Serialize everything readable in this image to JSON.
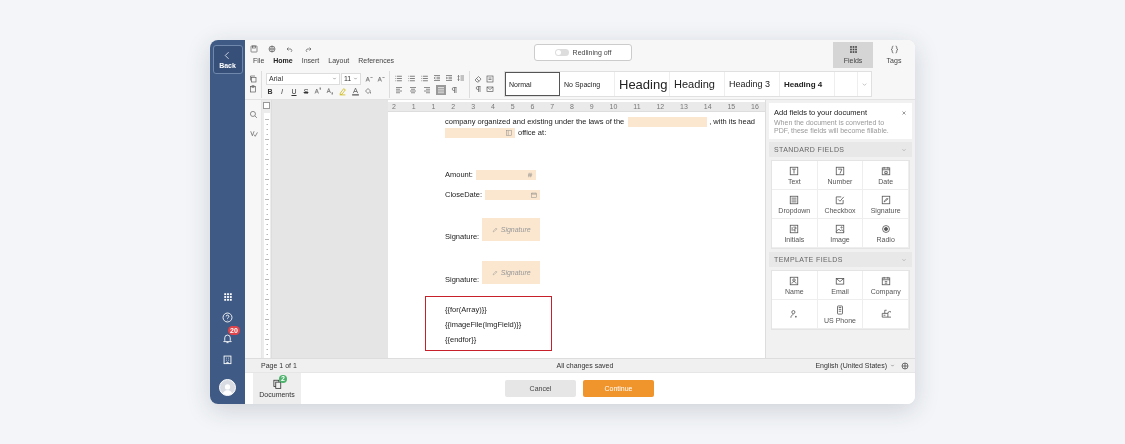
{
  "nav": {
    "back_label": "Back",
    "notification_count": "20"
  },
  "toolbar": {
    "menu_tabs": [
      {
        "label": "File",
        "selected": false
      },
      {
        "label": "Home",
        "selected": true
      },
      {
        "label": "Insert",
        "selected": false
      },
      {
        "label": "Layout",
        "selected": false
      },
      {
        "label": "References",
        "selected": false
      }
    ],
    "redlining": {
      "label": "Redlining off",
      "on": false
    },
    "panel_buttons": [
      {
        "label": "Fields",
        "kind": "fields",
        "selected": true
      },
      {
        "label": "Tags",
        "kind": "tags",
        "selected": false
      }
    ],
    "font": {
      "family": "Arial",
      "size": "11"
    },
    "format_buttons": [
      "B",
      "I",
      "U",
      "S"
    ],
    "align_buttons": [
      {
        "kind": "left",
        "selected": false
      },
      {
        "kind": "center",
        "selected": false
      },
      {
        "kind": "right",
        "selected": false
      },
      {
        "kind": "justify",
        "selected": true
      }
    ],
    "styles": [
      {
        "label": "Normal",
        "kind": "normal",
        "selected": true
      },
      {
        "label": "No Spacing",
        "kind": "nospacing",
        "selected": false
      },
      {
        "label": "Heading",
        "kind": "heading1",
        "selected": false
      },
      {
        "label": "Heading",
        "kind": "heading2",
        "selected": false
      },
      {
        "label": "Heading 3",
        "kind": "heading3",
        "selected": false
      },
      {
        "label": "Heading 4",
        "kind": "heading4",
        "selected": false
      }
    ]
  },
  "ruler": {
    "labels": [
      "2",
      "1",
      "1",
      "2",
      "3",
      "4",
      "5",
      "6",
      "7",
      "8",
      "9",
      "10",
      "11",
      "12",
      "13",
      "14",
      "15",
      "16"
    ]
  },
  "document": {
    "intro_before": "company organized and existing under the laws of the",
    "intro_after": ", with its head",
    "intro_next": "office at:",
    "lines": [
      {
        "label": "Amount:",
        "kind": "number"
      },
      {
        "label": "CloseDate:",
        "kind": "date"
      },
      {
        "label": "Signature:",
        "kind": "signature",
        "field_text": "Signature"
      },
      {
        "label": "Signature:",
        "kind": "signature",
        "field_text": "Signature"
      }
    ],
    "template_block": [
      "{{for(Array)}}",
      "{{imageFile(ImgField)}}",
      "{{endfor}}"
    ]
  },
  "fields_panel": {
    "title": "Add fields to your document",
    "description": "When the document is converted to PDF, these fields will become fillable.",
    "sections": [
      {
        "title": "STANDARD FIELDS",
        "expanded": true,
        "items": [
          {
            "label": "Text",
            "kind": "text"
          },
          {
            "label": "Number",
            "kind": "number"
          },
          {
            "label": "Date",
            "kind": "date"
          },
          {
            "label": "Dropdown",
            "kind": "dropdown"
          },
          {
            "label": "Checkbox",
            "kind": "checkbox"
          },
          {
            "label": "Signature",
            "kind": "signature"
          },
          {
            "label": "Initials",
            "kind": "initials"
          },
          {
            "label": "Image",
            "kind": "image"
          },
          {
            "label": "Radio",
            "kind": "radio"
          }
        ]
      },
      {
        "title": "TEMPLATE FIELDS",
        "expanded": true,
        "items": [
          {
            "label": "Name",
            "kind": "name"
          },
          {
            "label": "Email",
            "kind": "email"
          },
          {
            "label": "Company",
            "kind": "company"
          },
          {
            "kind": "person"
          },
          {
            "label": "US Phone",
            "kind": "phone"
          },
          {
            "kind": "mailbox"
          }
        ]
      }
    ]
  },
  "status_bar": {
    "page": "Page 1 of 1",
    "save_state": "All changes saved",
    "language": "English (United States)"
  },
  "footer": {
    "documents": {
      "label": "Documents",
      "badge": "2"
    },
    "buttons": [
      {
        "label": "Cancel",
        "kind": "secondary"
      },
      {
        "label": "Continue",
        "kind": "primary"
      }
    ]
  }
}
